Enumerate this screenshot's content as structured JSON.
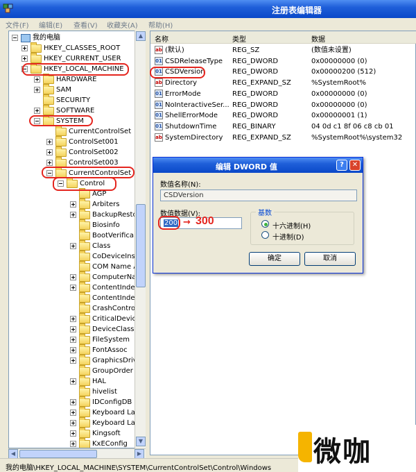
{
  "window": {
    "title": "注册表编辑器"
  },
  "menu": [
    "文件(F)",
    "编辑(E)",
    "查看(V)",
    "收藏夹(A)",
    "帮助(H)"
  ],
  "tree": [
    {
      "label": "我的电脑",
      "kind": "computer",
      "exp": "minus"
    },
    {
      "label": "HKEY_CLASSES_ROOT",
      "exp": "plus"
    },
    {
      "label": "HKEY_CURRENT_USER",
      "exp": "plus"
    },
    {
      "label": "HKEY_LOCAL_MACHINE",
      "exp": "minus"
    },
    {
      "label": "HARDWARE",
      "exp": "plus"
    },
    {
      "label": "SAM",
      "exp": "plus"
    },
    {
      "label": "SECURITY",
      "exp": "none"
    },
    {
      "label": "SOFTWARE",
      "exp": "plus"
    },
    {
      "label": "SYSTEM",
      "exp": "minus"
    },
    {
      "label": "CurrentControlSet",
      "exp": "none"
    },
    {
      "label": "ControlSet001",
      "exp": "plus"
    },
    {
      "label": "ControlSet002",
      "exp": "plus"
    },
    {
      "label": "ControlSet003",
      "exp": "plus"
    },
    {
      "label": "CurrentControlSet",
      "exp": "minus"
    },
    {
      "label": "Control",
      "exp": "minus"
    },
    {
      "label": "AGP",
      "exp": "none"
    },
    {
      "label": "Arbiters",
      "exp": "plus"
    },
    {
      "label": "BackupResto",
      "exp": "plus"
    },
    {
      "label": "Biosinfo",
      "exp": "none"
    },
    {
      "label": "BootVerifica",
      "exp": "none"
    },
    {
      "label": "Class",
      "exp": "plus"
    },
    {
      "label": "CoDeviceIns",
      "exp": "none"
    },
    {
      "label": "COM Name A",
      "exp": "none"
    },
    {
      "label": "ComputerNa",
      "exp": "plus"
    },
    {
      "label": "ContentInde",
      "exp": "plus"
    },
    {
      "label": "ContentInde",
      "exp": "none"
    },
    {
      "label": "CrashContro",
      "exp": "none"
    },
    {
      "label": "CriticalDevic",
      "exp": "plus"
    },
    {
      "label": "DeviceClass",
      "exp": "plus"
    },
    {
      "label": "FileSystem",
      "exp": "plus"
    },
    {
      "label": "FontAssoc",
      "exp": "plus"
    },
    {
      "label": "GraphicsDriv",
      "exp": "plus"
    },
    {
      "label": "GroupOrder",
      "exp": "none"
    },
    {
      "label": "HAL",
      "exp": "plus"
    },
    {
      "label": "hivelist",
      "exp": "none"
    },
    {
      "label": "IDConfigDB",
      "exp": "plus"
    },
    {
      "label": "Keyboard La",
      "exp": "plus"
    },
    {
      "label": "Keyboard La",
      "exp": "plus"
    },
    {
      "label": "Kingsoft",
      "exp": "plus"
    },
    {
      "label": "KxEConfig",
      "exp": "plus"
    }
  ],
  "list": {
    "headers": [
      "名称",
      "类型",
      "数据"
    ],
    "rows": [
      {
        "icon": "ab",
        "name": "(默认)",
        "type": "REG_SZ",
        "data": "(数值未设置)"
      },
      {
        "icon": "bin",
        "name": "CSDReleaseType",
        "type": "REG_DWORD",
        "data": "0x00000000 (0)"
      },
      {
        "icon": "bin",
        "name": "CSDVersion",
        "type": "REG_DWORD",
        "data": "0x00000200 (512)"
      },
      {
        "icon": "ab",
        "name": "Directory",
        "type": "REG_EXPAND_SZ",
        "data": "%SystemRoot%"
      },
      {
        "icon": "bin",
        "name": "ErrorMode",
        "type": "REG_DWORD",
        "data": "0x00000000 (0)"
      },
      {
        "icon": "bin",
        "name": "NoInteractiveSer...",
        "type": "REG_DWORD",
        "data": "0x00000000 (0)"
      },
      {
        "icon": "bin",
        "name": "ShellErrorMode",
        "type": "REG_DWORD",
        "data": "0x00000001 (1)"
      },
      {
        "icon": "bin",
        "name": "ShutdownTime",
        "type": "REG_BINARY",
        "data": "04 0d c1 8f 06 c8 cb 01"
      },
      {
        "icon": "ab",
        "name": "SystemDirectory",
        "type": "REG_EXPAND_SZ",
        "data": "%SystemRoot%\\system32"
      }
    ]
  },
  "dialog": {
    "title": "编辑 DWORD 值",
    "name_label": "数值名称(N):",
    "name_value": "CSDVersion",
    "data_label": "数值数据(V):",
    "data_value": "200",
    "base_title": "基数",
    "radio_hex": "十六进制(H)",
    "radio_dec": "十进制(D)",
    "hex_selected": true,
    "ok": "确定",
    "cancel": "取消",
    "help_glyph": "?",
    "close_glyph": "✕"
  },
  "annotation": {
    "arrow": "→",
    "new_value": "300"
  },
  "status": {
    "path": "我的电脑\\HKEY_LOCAL_MACHINE\\SYSTEM\\CurrentControlSet\\Control\\Windows"
  },
  "watermark": {
    "text": "微咖"
  },
  "colors": {
    "highlight": "#e4251e",
    "xp_blue": "#0a48c8",
    "accent": "#f5b400"
  }
}
